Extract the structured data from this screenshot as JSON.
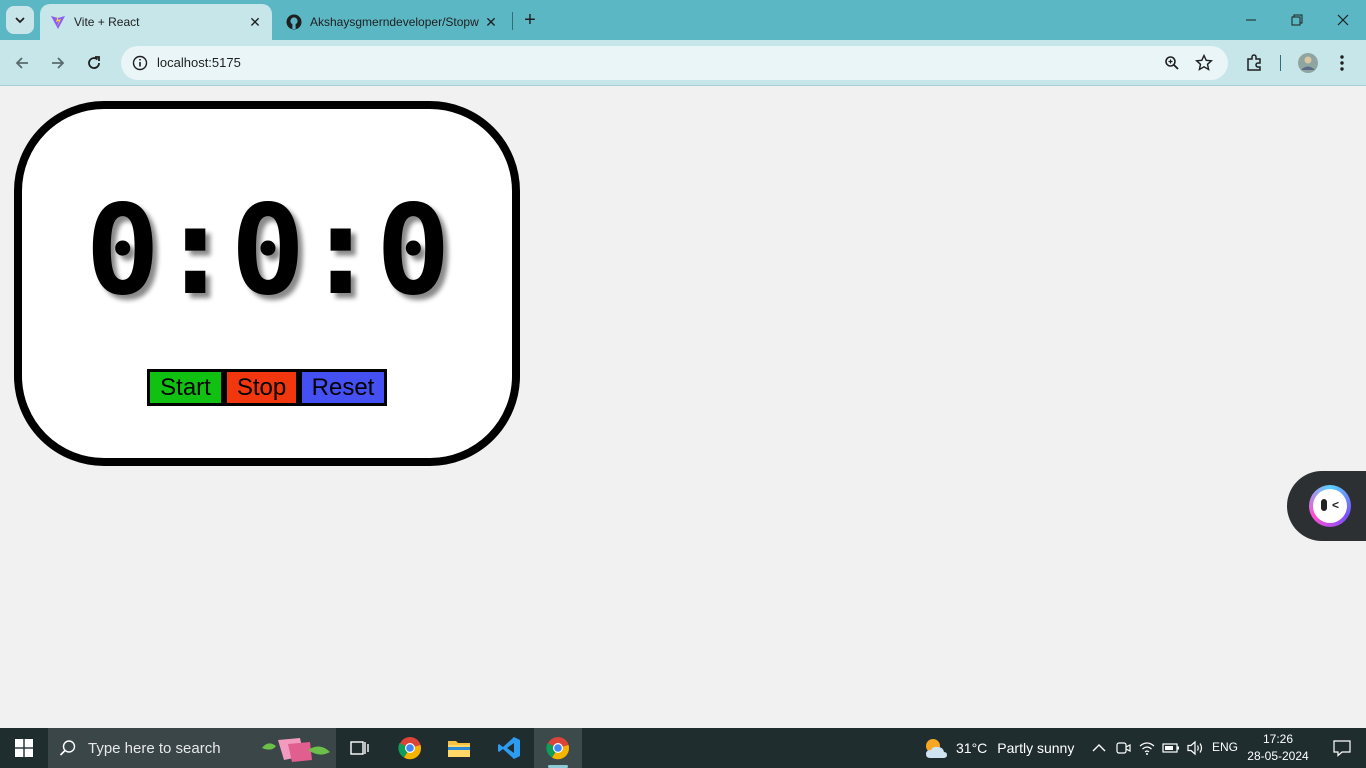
{
  "browser": {
    "tabs": [
      {
        "title": "Vite + React",
        "icon": "vite-icon",
        "active": true
      },
      {
        "title": "Akshaysgmerndeveloper/Stopw",
        "icon": "github-icon",
        "active": false
      }
    ],
    "url": "localhost:5175"
  },
  "stopwatch": {
    "time": "0:0:0",
    "buttons": {
      "start": "Start",
      "stop": "Stop",
      "reset": "Reset"
    },
    "colors": {
      "start": "#11c111",
      "stop": "#f2360e",
      "reset": "#4450f2"
    }
  },
  "taskbar": {
    "search_placeholder": "Type here to search",
    "weather": {
      "temp": "31°C",
      "condition": "Partly sunny"
    },
    "language": "ENG",
    "time": "17:26",
    "date": "28-05-2024"
  }
}
